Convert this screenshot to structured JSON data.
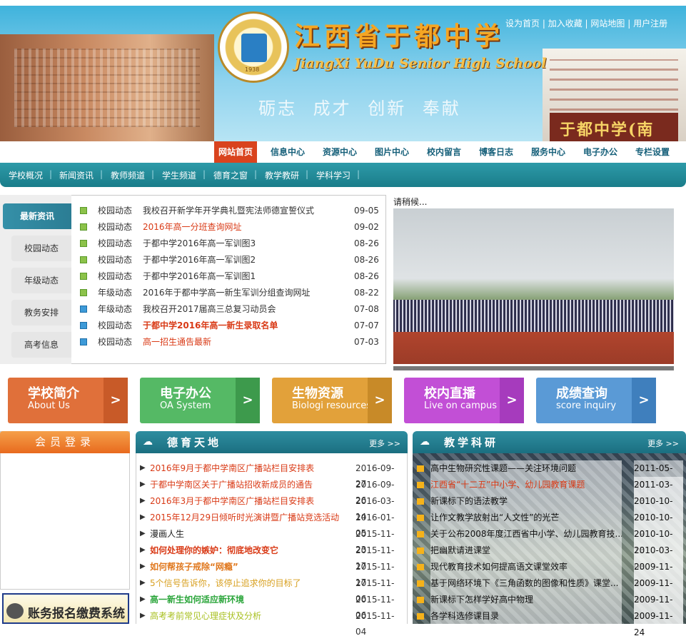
{
  "header": {
    "title_cn": "江西省于都中学",
    "title_en": "JiangXi YuDu Senior High School",
    "motto": "砺志 成才 创新 奉献",
    "seal_year": "1938",
    "gate_text": "于都中学(南区)",
    "top_links": [
      "设为首页",
      "加入收藏",
      "网站地图",
      "用户注册"
    ]
  },
  "nav": {
    "items": [
      "网站首页",
      "信息中心",
      "资源中心",
      "图片中心",
      "校内留言",
      "博客日志",
      "服务中心",
      "电子办公",
      "专栏设置"
    ]
  },
  "subnav": {
    "items": [
      "学校概况",
      "新闻资讯",
      "教师频道",
      "学生频道",
      "德育之窗",
      "教学教研",
      "学科学习"
    ]
  },
  "news_tabs": [
    "最新资讯",
    "校园动态",
    "年级动态",
    "教务安排",
    "高考信息"
  ],
  "news": [
    {
      "cat": "校园动态",
      "title": "我校召开新学年开学典礼暨宪法师德宣誓仪式",
      "date": "09-05"
    },
    {
      "cat": "校园动态",
      "title": "2016年高一分班查询网址",
      "date": "09-02"
    },
    {
      "cat": "校园动态",
      "title": "于都中学2016年高一军训图3",
      "date": "08-26"
    },
    {
      "cat": "校园动态",
      "title": "于都中学2016年高一军训图2",
      "date": "08-26"
    },
    {
      "cat": "校园动态",
      "title": "于都中学2016年高一军训图1",
      "date": "08-26"
    },
    {
      "cat": "年级动态",
      "title": "2016年于都中学高一新生军训分组查询网址",
      "date": "08-22"
    },
    {
      "cat": "年级动态",
      "title": "我校召开2017届高三总复习动员会",
      "date": "07-08"
    },
    {
      "cat": "校园动态",
      "title": "于都中学2016年高一新生录取名单",
      "date": "07-07"
    },
    {
      "cat": "校园动态",
      "title": "高一招生通告最新",
      "date": "07-03"
    }
  ],
  "photo": {
    "label": "请稍候..."
  },
  "quick_buttons": [
    {
      "cn": "学校简介",
      "en": "About Us",
      "color": "#e0703a",
      "dark": "#c85a28"
    },
    {
      "cn": "电子办公",
      "en": "OA System",
      "color": "#55b965",
      "dark": "#3d9a4c"
    },
    {
      "cn": "生物资源",
      "en": "Biologi resources",
      "color": "#e2a13a",
      "dark": "#c88a28"
    },
    {
      "cn": "校内直播",
      "en": "Live on campus",
      "color": "#c24fd6",
      "dark": "#a63bbd"
    },
    {
      "cn": "成绩查询",
      "en": "score inquiry",
      "color": "#5a9ad6",
      "dark": "#3f7fbd"
    }
  ],
  "login": {
    "title": "会员登录"
  },
  "pay_banner": "账务报名缴费系统",
  "arrow": ">",
  "moral": {
    "title": "德育天地",
    "more": "更多 >>",
    "items": [
      {
        "title": "2016年9月于都中学南区广播站栏目安排表",
        "date": "2016-09-27",
        "style": "c-red"
      },
      {
        "title": "于都中学南区关于广播站招收新成员的通告",
        "date": "2016-09-26",
        "style": "c-red"
      },
      {
        "title": "2016年3月于都中学南区广播站栏目安排表",
        "date": "2016-03-14",
        "style": "c-red"
      },
      {
        "title": "2015年12月29日倾听时光演讲暨广播站竞选活动",
        "date": "2016-01-05",
        "style": "c-red"
      },
      {
        "title": "漫画人生",
        "date": "2015-11-23",
        "style": "c-blk"
      },
      {
        "title": "如何处理你的嫉妒：彻底地改变它",
        "date": "2015-11-17",
        "style": "c-redb"
      },
      {
        "title": "如何帮孩子戒除“网瘾”",
        "date": "2015-11-17",
        "style": "c-org"
      },
      {
        "title": "5个信号告诉你，该停止追求你的目标了",
        "date": "2015-11-06",
        "style": "c-ylw"
      },
      {
        "title": "高一新生如何适应新环境",
        "date": "2015-11-06",
        "style": "c-grn"
      },
      {
        "title": "高考考前常见心理症状及分析",
        "date": "2015-11-04",
        "style": "c-ylg"
      }
    ]
  },
  "research": {
    "title": "教学科研",
    "more": "更多 >>",
    "items": [
      {
        "title": "高中生物研究性课题——关注环境问题",
        "date": "2011-05-30",
        "red": false
      },
      {
        "title": "江西省“十二五”中小学、幼儿园教育课题",
        "date": "2011-03-23",
        "red": true
      },
      {
        "title": "新课标下的语法教学",
        "date": "2010-10-29",
        "red": false
      },
      {
        "title": "让作文教学放射出“人文性”的光芒",
        "date": "2010-10-29",
        "red": false
      },
      {
        "title": "关于公布2008年度江西省中小学、幼儿园教育技...",
        "date": "2010-10-13",
        "red": false
      },
      {
        "title": "把幽默请进课堂",
        "date": "2010-03-03",
        "red": false
      },
      {
        "title": "现代教育技术如何提高语文课堂效率",
        "date": "2009-11-30",
        "red": false
      },
      {
        "title": "基于网络环境下《三角函数的图像和性质》课堂...",
        "date": "2009-11-30",
        "red": false
      },
      {
        "title": "新课标下怎样学好高中物理",
        "date": "2009-11-30",
        "red": false
      },
      {
        "title": "各学科选修课目录",
        "date": "2009-11-24",
        "red": false
      }
    ]
  }
}
